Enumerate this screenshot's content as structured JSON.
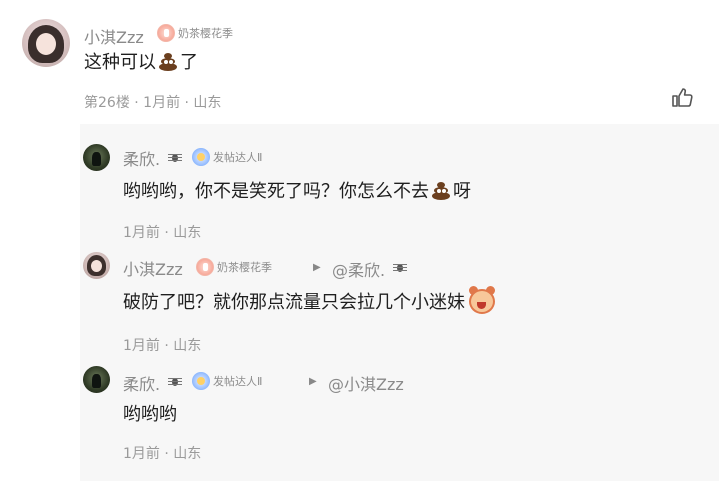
{
  "main": {
    "username": "小淇Zzz",
    "badge": "奶茶樱花季",
    "text": "这种可以",
    "text_end": "了",
    "meta": "第26楼 · 1月前 · 山东"
  },
  "replies": [
    {
      "username": "柔欣.",
      "badge": "发帖达人Ⅱ",
      "text": "哟哟哟，你不是笑死了吗？你怎么不去",
      "text_end": "呀",
      "meta": "1月前 · 山东"
    },
    {
      "username": "小淇Zzz",
      "badge": "奶茶樱花季",
      "reply_to": "@柔欣.",
      "text": "破防了吧？就你那点流量只会拉几个小迷妹",
      "meta": "1月前 · 山东"
    },
    {
      "username": "柔欣.",
      "badge": "发帖达人Ⅱ",
      "reply_to": "@小淇Zzz",
      "text": "哟哟哟",
      "meta": "1月前 · 山东"
    }
  ],
  "icons": {
    "like": "thumbs-up-icon",
    "poop": "poop-emoji",
    "sticker": "cat-sticker-emoji"
  }
}
